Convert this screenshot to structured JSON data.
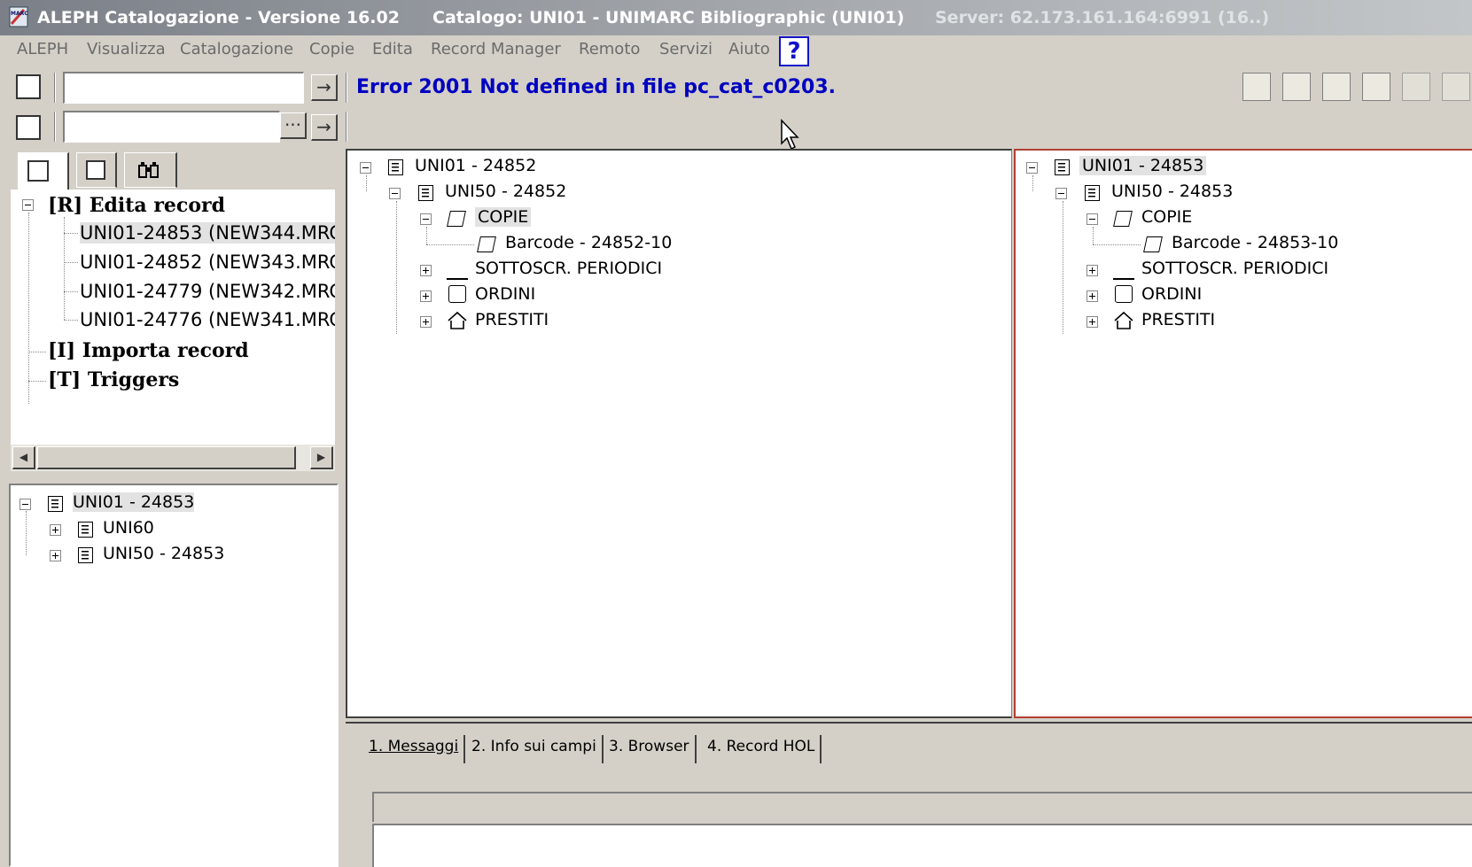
{
  "window": {
    "app_title": "ALEPH Catalogazione - Versione 16.02",
    "catalog_title": "Catalogo: UNI01 - UNIMARC Bibliographic (UNI01)",
    "server_title": "Server: 62.173.161.164:6991 (16..)"
  },
  "menu": {
    "items": [
      "ALEPH",
      "Visualizza",
      "Catalogazione",
      "Copie",
      "Edita",
      "Record Manager",
      "Remoto",
      "Servizi",
      "Aiuto"
    ],
    "help_label": "?"
  },
  "toolbar": {
    "go_arrow": "→",
    "browse_label": "···",
    "error_message": "Error 2001 Not defined in file pc_cat_c0203."
  },
  "left_tree": {
    "root": "[R] Edita record",
    "records": [
      "UNI01-24853 (NEW344.MRC",
      "UNI01-24852 (NEW343.MRC",
      "UNI01-24779 (NEW342.MRC",
      "UNI01-24776 (NEW341.MRC"
    ],
    "import": "[I] Importa record",
    "triggers": "[T] Triggers"
  },
  "left_bottom_tree": {
    "root": "UNI01 - 24853",
    "children": [
      "UNI60",
      "UNI50 - 24853"
    ]
  },
  "center_tree": {
    "root": "UNI01 - 24852",
    "adm": "UNI50 - 24852",
    "copie": "COPIE",
    "barcode": "Barcode - 24852-10",
    "sottoscr": "SOTTOSCR. PERIODICI",
    "ordini": "ORDINI",
    "prestiti": "PRESTITI"
  },
  "right_tree": {
    "root": "UNI01 - 24853",
    "adm": "UNI50 - 24853",
    "copie": "COPIE",
    "barcode": "Barcode - 24853-10",
    "sottoscr": "SOTTOSCR. PERIODICI",
    "ordini": "ORDINI",
    "prestiti": "PRESTITI"
  },
  "bottom_tabs": [
    "1. Messaggi",
    "2. Info sui campi",
    "3. Browser",
    "4. Record HOL"
  ],
  "colors": {
    "error_text": "#0000c0",
    "active_border": "#b04030",
    "help": "#1111cc"
  }
}
